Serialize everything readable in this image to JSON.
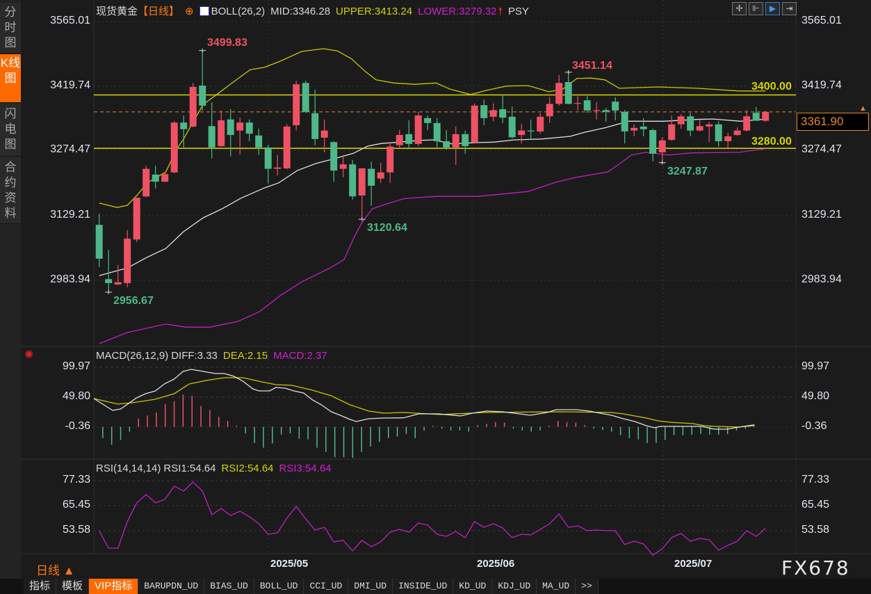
{
  "sidebar": {
    "tabs": [
      {
        "label": "分时图"
      },
      {
        "label": "K线图"
      },
      {
        "label": "闪电图"
      },
      {
        "label": "合约资料"
      }
    ]
  },
  "header": {
    "instrument": "现货黄金",
    "period_tag": "【日线】",
    "boll": "BOLL(26,2)",
    "mid": "MID:3346.28",
    "upper": "UPPER:3413.24",
    "lower": "LOWER:3279.32",
    "psy": "PSY"
  },
  "toolbar": {
    "icons": [
      "crosshair-icon",
      "range-icon",
      "play-cursor-icon",
      "move-right-icon"
    ]
  },
  "main_axis": {
    "labels": [
      "3565.01",
      "3419.74",
      "3274.47",
      "3129.21",
      "2983.94"
    ]
  },
  "last_price": "3361.90",
  "levels": [
    {
      "label": "3400.00",
      "value": 3400
    },
    {
      "label": "3280.00",
      "value": 3280
    }
  ],
  "annotations": {
    "high": "3499.83",
    "low": "2956.67",
    "low2": "3120.64",
    "high2": "3451.14",
    "low3": "3247.87"
  },
  "macd": {
    "title": "MACD(26,12,9)",
    "diff": "DIFF:3.33",
    "dea": "DEA:2.15",
    "macd": "MACD:2.37",
    "axis": [
      "99.97",
      "49.80",
      "-0.36"
    ]
  },
  "rsi": {
    "title": "RSI(14,14,14)",
    "rsi1": "RSI1:54.64",
    "rsi2": "RSI2:54.64",
    "rsi3": "RSI3:54.64",
    "axis": [
      "77.33",
      "65.45",
      "53.58"
    ]
  },
  "dates": [
    "2025/05",
    "2025/06",
    "2025/07"
  ],
  "period": "日线 ▲",
  "logo": "FX678",
  "bottom_tabs": [
    "指标",
    "模板",
    "VIP指标",
    "BARUPDN_UD",
    "BIAS_UD",
    "BOLL_UD",
    "CCI_UD",
    "DMI_UD",
    "INSIDE_UD",
    "KD_UD",
    "KDJ_UD",
    "MA_UD",
    ">>"
  ],
  "colors": {
    "up": "#ef5264",
    "down": "#4fb88a",
    "upper": "#c8c800",
    "mid": "#e0e0e0",
    "lower": "#c020c0",
    "accent": "#ff6a00"
  },
  "chart_data": {
    "type": "candlestick",
    "candles": [
      [
        3108,
        3133,
        3013,
        3032
      ],
      [
        2986,
        3052,
        2957,
        2977
      ],
      [
        2974,
        3018,
        2972,
        2979
      ],
      [
        2977,
        3096,
        2968,
        3077
      ],
      [
        3075,
        3169,
        3069,
        3169
      ],
      [
        3172,
        3241,
        3170,
        3234
      ],
      [
        3221,
        3241,
        3190,
        3205
      ],
      [
        3205,
        3226,
        3204,
        3222
      ],
      [
        3226,
        3341,
        3224,
        3338
      ],
      [
        3338,
        3354,
        3282,
        3323
      ],
      [
        3329,
        3427,
        3327,
        3418
      ],
      [
        3421,
        3499.83,
        3365,
        3376
      ],
      [
        3330,
        3384,
        3257,
        3282
      ],
      [
        3285,
        3365,
        3283,
        3343
      ],
      [
        3345,
        3368,
        3262,
        3310
      ],
      [
        3320,
        3349,
        3266,
        3338
      ],
      [
        3338,
        3345,
        3296,
        3313
      ],
      [
        3309,
        3324,
        3265,
        3282
      ],
      [
        3282,
        3288,
        3201,
        3234
      ],
      [
        3234,
        3265,
        3219,
        3237
      ],
      [
        3235,
        3334,
        3233,
        3329
      ],
      [
        3332,
        3432,
        3320,
        3424
      ],
      [
        3427,
        3432,
        3359,
        3362
      ],
      [
        3359,
        3412,
        3287,
        3301
      ],
      [
        3304,
        3345,
        3271,
        3320
      ],
      [
        3294,
        3296,
        3205,
        3230
      ],
      [
        3234,
        3265,
        3215,
        3244
      ],
      [
        3244,
        3254,
        3165,
        3172
      ],
      [
        3174,
        3235,
        3120.64,
        3235
      ],
      [
        3234,
        3250,
        3151,
        3196
      ],
      [
        3212,
        3248,
        3202,
        3226
      ],
      [
        3226,
        3293,
        3202,
        3284
      ],
      [
        3287,
        3321,
        3282,
        3310
      ],
      [
        3312,
        3343,
        3278,
        3290
      ],
      [
        3290,
        3362,
        3285,
        3354
      ],
      [
        3348,
        3354,
        3321,
        3337
      ],
      [
        3337,
        3348,
        3282,
        3296
      ],
      [
        3296,
        3321,
        3277,
        3282
      ],
      [
        3282,
        3329,
        3243,
        3312
      ],
      [
        3312,
        3320,
        3268,
        3285
      ],
      [
        3293,
        3381,
        3291,
        3376
      ],
      [
        3377,
        3390,
        3332,
        3348
      ],
      [
        3351,
        3381,
        3341,
        3366
      ],
      [
        3368,
        3398,
        3337,
        3349
      ],
      [
        3351,
        3374,
        3302,
        3305
      ],
      [
        3310,
        3335,
        3291,
        3320
      ],
      [
        3320,
        3345,
        3299,
        3318
      ],
      [
        3318,
        3359,
        3313,
        3351
      ],
      [
        3352,
        3395,
        3337,
        3380
      ],
      [
        3380,
        3445,
        3376,
        3427
      ],
      [
        3429,
        3451.14,
        3379,
        3380
      ],
      [
        3381,
        3398,
        3365,
        3382
      ],
      [
        3388,
        3398,
        3360,
        3365
      ],
      [
        3365,
        3384,
        3345,
        3366
      ],
      [
        3366,
        3371,
        3340,
        3362
      ],
      [
        3385,
        3395,
        3343,
        3365
      ],
      [
        3362,
        3366,
        3291,
        3318
      ],
      [
        3320,
        3334,
        3307,
        3326
      ],
      [
        3329,
        3348,
        3307,
        3323
      ],
      [
        3321,
        3324,
        3251,
        3268
      ],
      [
        3271,
        3305,
        3247.87,
        3298
      ],
      [
        3299,
        3354,
        3297,
        3334
      ],
      [
        3334,
        3357,
        3324,
        3352
      ],
      [
        3352,
        3360,
        3307,
        3320
      ],
      [
        3320,
        3343,
        3318,
        3330
      ],
      [
        3329,
        3340,
        3294,
        3334
      ],
      [
        3334,
        3341,
        3284,
        3296
      ],
      [
        3296,
        3315,
        3280,
        3307
      ],
      [
        3310,
        3327,
        3308,
        3320
      ],
      [
        3320,
        3366,
        3318,
        3352
      ],
      [
        3360,
        3373,
        3342,
        3342
      ],
      [
        3342,
        3364,
        3340,
        3361.9
      ]
    ],
    "boll_upper": [
      [
        1,
        3157
      ],
      [
        2.9,
        3147
      ],
      [
        4,
        3152
      ],
      [
        5.1,
        3176
      ],
      [
        6.1,
        3202
      ],
      [
        8.1,
        3227
      ],
      [
        9.3,
        3280
      ],
      [
        10,
        3301
      ],
      [
        11.1,
        3343
      ],
      [
        12.1,
        3379
      ],
      [
        13.6,
        3402
      ],
      [
        15.1,
        3426
      ],
      [
        17.1,
        3457
      ],
      [
        18.6,
        3462
      ],
      [
        20.3,
        3476
      ],
      [
        22.6,
        3498
      ],
      [
        24.9,
        3504
      ],
      [
        26.4,
        3499
      ],
      [
        27.9,
        3481
      ],
      [
        29.4,
        3452
      ],
      [
        30.5,
        3434
      ],
      [
        32.4,
        3427
      ],
      [
        34.6,
        3424
      ],
      [
        36.9,
        3427
      ],
      [
        38.4,
        3413
      ],
      [
        40.6,
        3401
      ],
      [
        42.2,
        3410
      ],
      [
        44.4,
        3420
      ],
      [
        46.7,
        3421
      ],
      [
        48.2,
        3412
      ],
      [
        48.9,
        3407
      ],
      [
        50.4,
        3413
      ],
      [
        51.9,
        3437
      ],
      [
        53.4,
        3438
      ],
      [
        54.9,
        3434
      ],
      [
        56.4,
        3415
      ],
      [
        60.6,
        3418
      ],
      [
        64.7,
        3415
      ],
      [
        69.2,
        3409
      ],
      [
        72,
        3409
      ]
    ],
    "boll_mid": [
      [
        1,
        2994
      ],
      [
        4,
        3011
      ],
      [
        6.1,
        3035
      ],
      [
        8.1,
        3055
      ],
      [
        10,
        3093
      ],
      [
        12.1,
        3124
      ],
      [
        14.1,
        3144
      ],
      [
        16.1,
        3168
      ],
      [
        18.6,
        3191
      ],
      [
        20.1,
        3202
      ],
      [
        22.1,
        3230
      ],
      [
        24.1,
        3246
      ],
      [
        26.1,
        3257
      ],
      [
        28.1,
        3269
      ],
      [
        29.6,
        3285
      ],
      [
        31.1,
        3291
      ],
      [
        33.1,
        3294
      ],
      [
        35.1,
        3298
      ],
      [
        36.6,
        3299
      ],
      [
        38.6,
        3290
      ],
      [
        41.2,
        3293
      ],
      [
        43.1,
        3294
      ],
      [
        45.2,
        3299
      ],
      [
        48.2,
        3301
      ],
      [
        51.2,
        3307
      ],
      [
        52.7,
        3316
      ],
      [
        54.9,
        3326
      ],
      [
        57.4,
        3341
      ],
      [
        61.2,
        3341
      ],
      [
        64.7,
        3345
      ],
      [
        66.4,
        3346
      ],
      [
        69.4,
        3341
      ],
      [
        72,
        3346
      ]
    ],
    "boll_lower": [
      [
        1,
        2841
      ],
      [
        4,
        2866
      ],
      [
        8.1,
        2885
      ],
      [
        10.2,
        2878
      ],
      [
        12.8,
        2878
      ],
      [
        15.8,
        2891
      ],
      [
        18.1,
        2913
      ],
      [
        20.3,
        2949
      ],
      [
        22.6,
        2980
      ],
      [
        25.6,
        3011
      ],
      [
        27.1,
        3030
      ],
      [
        28.2,
        3082
      ],
      [
        29,
        3113
      ],
      [
        30.1,
        3144
      ],
      [
        31.6,
        3155
      ],
      [
        33.5,
        3167
      ],
      [
        36.9,
        3172
      ],
      [
        41.4,
        3172
      ],
      [
        46.7,
        3183
      ],
      [
        49.7,
        3204
      ],
      [
        51.9,
        3215
      ],
      [
        53.8,
        3222
      ],
      [
        55.2,
        3227
      ],
      [
        56.7,
        3249
      ],
      [
        57.7,
        3265
      ],
      [
        59.2,
        3271
      ],
      [
        61.7,
        3265
      ],
      [
        64.2,
        3270
      ],
      [
        69.2,
        3271
      ],
      [
        72,
        3279
      ]
    ],
    "price_range": [
      2860,
      3565.01
    ],
    "macd_hist": [
      -0.5,
      -19,
      -30,
      -22,
      -8,
      14,
      19,
      24,
      38,
      43,
      54,
      52,
      35,
      28,
      17,
      10,
      2,
      -11,
      -27,
      -35,
      -28,
      -13,
      -11,
      -20,
      -21,
      -35,
      -42,
      -51,
      -51,
      -52,
      -42,
      -33,
      -25,
      -19,
      -16,
      -12,
      -19,
      -6,
      2,
      -3,
      -6,
      -6,
      -8,
      3,
      5,
      8,
      7,
      -3,
      -6,
      -8,
      -6,
      2,
      10,
      8,
      7,
      3,
      -3,
      -5,
      -8,
      -14,
      -19,
      -21,
      -27,
      -27,
      -22,
      -14,
      -14,
      -13,
      -12,
      -13,
      -13,
      -12,
      -6,
      -3,
      2.37
    ],
    "diff": [
      [
        1,
        47.5
      ],
      [
        3.1,
        27.6
      ],
      [
        4,
        30
      ],
      [
        5.8,
        48.7
      ],
      [
        6.8,
        55.7
      ],
      [
        7.9,
        60.3
      ],
      [
        8.9,
        72
      ],
      [
        10,
        80.2
      ],
      [
        11,
        93
      ],
      [
        11.9,
        96.5
      ],
      [
        12.8,
        94.2
      ],
      [
        14.6,
        89.5
      ],
      [
        15.6,
        89.5
      ],
      [
        16.7,
        84.8
      ],
      [
        17.7,
        76.7
      ],
      [
        18.8,
        63.8
      ],
      [
        19.5,
        60.3
      ],
      [
        20.7,
        60.3
      ],
      [
        21.4,
        66.2
      ],
      [
        22.4,
        65
      ],
      [
        23.4,
        60.3
      ],
      [
        24.5,
        56.8
      ],
      [
        25.5,
        45.1
      ],
      [
        26.5,
        37
      ],
      [
        27.6,
        25.3
      ],
      [
        28.6,
        19.5
      ],
      [
        29.7,
        12.5
      ],
      [
        30.4,
        9
      ],
      [
        31.8,
        13.6
      ],
      [
        33.5,
        14.8
      ],
      [
        35.7,
        15.2
      ],
      [
        37.4,
        21.8
      ],
      [
        39.6,
        21.8
      ],
      [
        42.1,
        18.3
      ],
      [
        43.4,
        23
      ],
      [
        45,
        26.5
      ],
      [
        46.8,
        25.3
      ],
      [
        48.7,
        21.8
      ],
      [
        49.9,
        19.5
      ],
      [
        51.8,
        24.1
      ],
      [
        52.8,
        28.8
      ],
      [
        55.1,
        28.8
      ],
      [
        56.5,
        26.5
      ],
      [
        57.7,
        23
      ],
      [
        59,
        19.5
      ],
      [
        60.3,
        13.6
      ],
      [
        61.6,
        9
      ],
      [
        62.9,
        2
      ],
      [
        63.8,
        -1.5
      ],
      [
        64.5,
        0.8
      ],
      [
        69.1,
        0.8
      ],
      [
        70.5,
        -3.9
      ],
      [
        72,
        -3.9
      ],
      [
        72.8,
        -1.5
      ],
      [
        75,
        3.33
      ]
    ],
    "dea": [
      [
        1,
        47.5
      ],
      [
        3.7,
        38.2
      ],
      [
        5.3,
        40.5
      ],
      [
        7.9,
        46.3
      ],
      [
        10,
        55.7
      ],
      [
        11.7,
        72
      ],
      [
        13.6,
        77.8
      ],
      [
        15.6,
        82.5
      ],
      [
        17.7,
        82.5
      ],
      [
        19.8,
        75.5
      ],
      [
        21.4,
        70.8
      ],
      [
        23.2,
        69.7
      ],
      [
        25.5,
        61.5
      ],
      [
        27.6,
        52.1
      ],
      [
        29.7,
        37
      ],
      [
        31.8,
        26.5
      ],
      [
        33.5,
        23
      ],
      [
        35.7,
        24.1
      ],
      [
        39.8,
        20.6
      ],
      [
        44.8,
        24.1
      ],
      [
        53.4,
        25.3
      ],
      [
        59,
        24.1
      ],
      [
        60.3,
        21.8
      ],
      [
        61.6,
        18.3
      ],
      [
        62.9,
        14.8
      ],
      [
        64.2,
        10.1
      ],
      [
        65.5,
        7.8
      ],
      [
        68.1,
        5.5
      ],
      [
        69.4,
        2
      ],
      [
        70.7,
        0.8
      ],
      [
        73.3,
        -0.4
      ],
      [
        75,
        2.15
      ]
    ],
    "rsi": [
      53.5,
      45.3,
      45.3,
      57.9,
      66.8,
      70.7,
      66.8,
      68.4,
      74.7,
      72.4,
      76.7,
      72.4,
      61.2,
      64.1,
      60.8,
      62.8,
      60.2,
      56.9,
      51.9,
      52.6,
      59.5,
      65.1,
      59.2,
      53.9,
      55.2,
      48.3,
      49,
      44,
      49,
      46,
      48.3,
      52.9,
      54.2,
      52.9,
      57.2,
      56.2,
      51.9,
      50.9,
      53.2,
      50.3,
      57.9,
      55.2,
      56.9,
      54.9,
      50.3,
      51.9,
      51.6,
      54.2,
      56.9,
      61.5,
      55.2,
      55.9,
      53.6,
      53.9,
      53.6,
      53.6,
      47,
      48.6,
      47.3,
      42,
      45,
      50.3,
      52.3,
      48.6,
      49.9,
      49.3,
      44.3,
      46.6,
      48.6,
      53.6,
      50.9,
      54.64
    ]
  }
}
